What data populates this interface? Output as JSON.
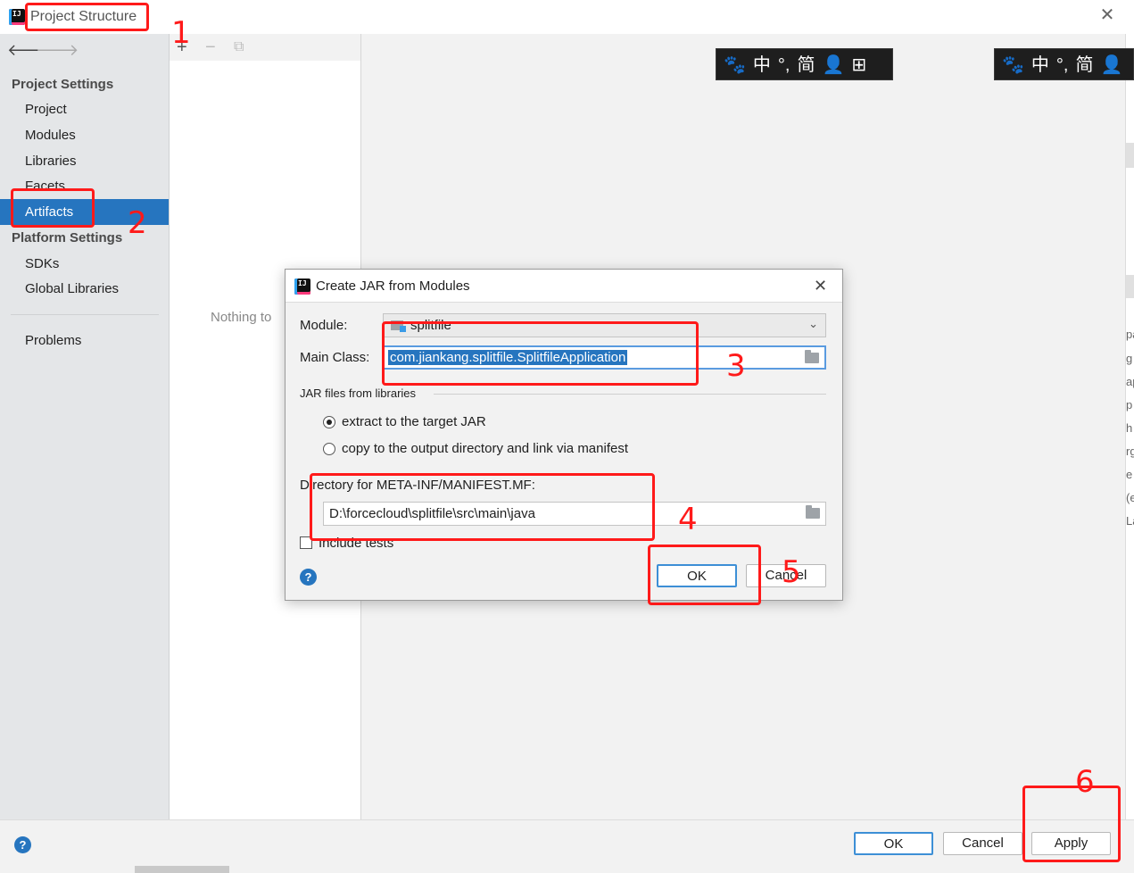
{
  "window": {
    "title": "Project Structure"
  },
  "sidebar": {
    "project_settings_header": "Project Settings",
    "items": [
      {
        "label": "Project"
      },
      {
        "label": "Modules"
      },
      {
        "label": "Libraries"
      },
      {
        "label": "Facets"
      },
      {
        "label": "Artifacts",
        "selected": true
      }
    ],
    "platform_settings_header": "Platform Settings",
    "platform_items": [
      {
        "label": "SDKs"
      },
      {
        "label": "Global Libraries"
      }
    ],
    "problems_label": "Problems"
  },
  "middle_panel": {
    "toolbar": {
      "add": "+",
      "remove": "−",
      "copy": "⧉"
    },
    "empty_text": "Nothing to"
  },
  "ime_bar": [
    "🐾",
    "中",
    "°,",
    "简",
    "👤",
    "⊞"
  ],
  "right_strip_chars": [
    "pa",
    "g",
    "ap",
    "p",
    "h",
    "rg",
    "e",
    "(e",
    "La"
  ],
  "dialog": {
    "title": "Create JAR from Modules",
    "module_label": "Module:",
    "module_value": "splitfile",
    "main_class_label": "Main Class:",
    "main_class_value": "com.jiankang.splitfile.SplitfileApplication",
    "jar_files_section": "JAR files from libraries",
    "radio_extract": "extract to the target JAR",
    "radio_copy": "copy to the output directory and link via manifest",
    "manifest_dir_label": "Directory for META-INF/MANIFEST.MF:",
    "manifest_dir_value": "D:\\forcecloud\\splitfile\\src\\main\\java",
    "include_tests_label": "Include tests",
    "ok_label": "OK",
    "cancel_label": "Cancel",
    "help": "?"
  },
  "footer": {
    "help": "?",
    "ok_label": "OK",
    "cancel_label": "Cancel",
    "apply_label": "Apply"
  },
  "annotations": [
    "1",
    "2",
    "3",
    "4",
    "5",
    "6"
  ],
  "colors": {
    "selection": "#2675bf",
    "annotation": "#ff1a1a",
    "default_button_border": "#3d8fd6"
  }
}
